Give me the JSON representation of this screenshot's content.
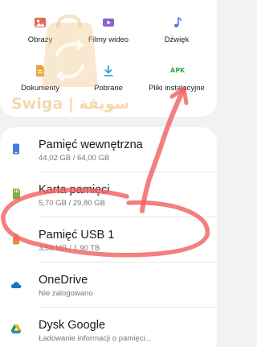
{
  "categories": [
    {
      "label": "Obrazy",
      "icon": "image-icon",
      "color": "#e06a52"
    },
    {
      "label": "Filmy wideo",
      "icon": "video-icon",
      "color": "#8e5fd3"
    },
    {
      "label": "Dźwięk",
      "icon": "music-note-icon",
      "color": "#5b7fe0"
    },
    {
      "label": "Dokumenty",
      "icon": "document-icon",
      "color": "#e9a53a"
    },
    {
      "label": "Pobrane",
      "icon": "download-icon",
      "color": "#2fa6c9"
    },
    {
      "label": "Pliki instalacyjne",
      "icon": "apk-icon",
      "color": "#36a84a",
      "badge": "APK"
    }
  ],
  "storage": [
    {
      "name": "Pamięć wewnętrzna",
      "detail": "44,02 GB / 64,00 GB",
      "icon": "phone-storage-icon",
      "color": "#3b82d9"
    },
    {
      "name": "Karta pamięci",
      "detail": "5,70 GB / 29,80 GB",
      "icon": "sd-card-icon",
      "color": "#7fb23a"
    },
    {
      "name": "Pamięć USB 1",
      "detail": "3,50 MB / 1,90 TB",
      "icon": "usb-icon",
      "color": "#e9873a"
    },
    {
      "name": "OneDrive",
      "detail": "Nie zalogowano",
      "icon": "cloud-icon",
      "color": "#1a73c9"
    },
    {
      "name": "Dysk Google",
      "detail": "Ładowanie informacji o pamięci...",
      "icon": "google-drive-icon",
      "color": "#f2b705"
    }
  ],
  "watermark": {
    "text": "Swiga | سويقة"
  },
  "colors": {
    "annotation": "#f06464",
    "watermark": "#eebe78"
  }
}
